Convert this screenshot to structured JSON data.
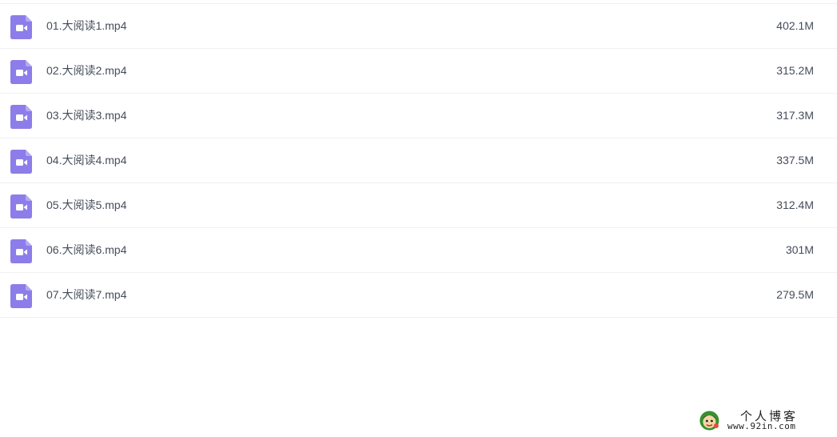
{
  "colors": {
    "icon_purple": "#8c7dea",
    "text": "#454d5a",
    "divider": "#f0f0f2"
  },
  "files": [
    {
      "name": "01.大阅读1.mp4",
      "size": "402.1M",
      "icon": "video-file-icon"
    },
    {
      "name": "02.大阅读2.mp4",
      "size": "315.2M",
      "icon": "video-file-icon"
    },
    {
      "name": "03.大阅读3.mp4",
      "size": "317.3M",
      "icon": "video-file-icon"
    },
    {
      "name": "04.大阅读4.mp4",
      "size": "337.5M",
      "icon": "video-file-icon"
    },
    {
      "name": "05.大阅读5.mp4",
      "size": "312.4M",
      "icon": "video-file-icon"
    },
    {
      "name": "06.大阅读6.mp4",
      "size": "301M",
      "icon": "video-file-icon"
    },
    {
      "name": "07.大阅读7.mp4",
      "size": "279.5M",
      "icon": "video-file-icon"
    }
  ],
  "watermark": {
    "title": "个人博客",
    "url": "www.92in.com"
  }
}
